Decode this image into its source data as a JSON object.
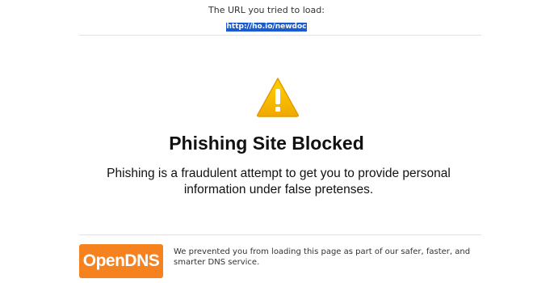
{
  "header": {
    "caption": "The URL you tried to load:",
    "url": "http://ho.io/newdoc"
  },
  "warning": {
    "icon": "warning-triangle-icon",
    "color": "#f5b800"
  },
  "main": {
    "title": "Phishing Site Blocked",
    "message": "Phishing is a fraudulent attempt to get you to provide personal information under false pretenses."
  },
  "footer": {
    "logo_text": "OpenDNS",
    "logo_color": "#f5821f",
    "note": "We prevented you from loading this page as part of our safer, faster, and smarter DNS service."
  }
}
